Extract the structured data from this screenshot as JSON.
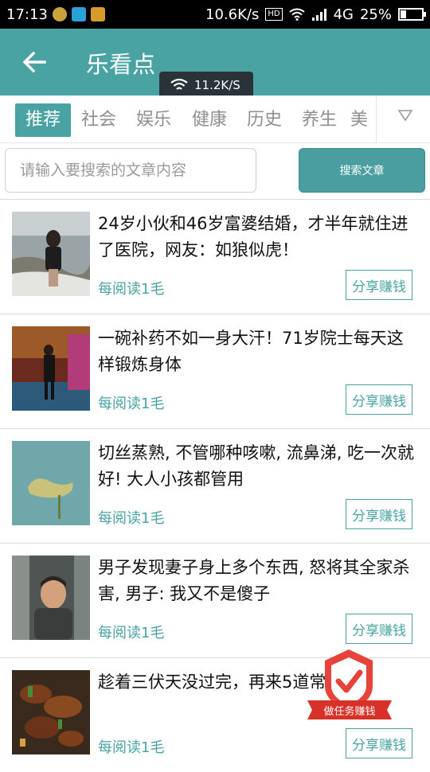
{
  "status_bar": {
    "time": "17:13",
    "net_speed": "10.6K/s",
    "hd": "HD",
    "network": "4G",
    "battery": "25%",
    "battery_level": 0.25
  },
  "app_bar": {
    "title": "乐看点",
    "network_toast": "11.2K/S"
  },
  "tabs": [
    {
      "label": "推荐",
      "active": true
    },
    {
      "label": "社会",
      "active": false
    },
    {
      "label": "娱乐",
      "active": false
    },
    {
      "label": "健康",
      "active": false
    },
    {
      "label": "历史",
      "active": false
    },
    {
      "label": "养生",
      "active": false
    },
    {
      "label": "美",
      "active": false
    }
  ],
  "search": {
    "placeholder": "请输入要搜索的文章内容",
    "button_label": "搜索文章"
  },
  "articles": [
    {
      "title": "24岁小伙和46岁富婆结婚，才半年就住进了医院，网友：如狼似虎！",
      "meta": "每阅读1毛",
      "share_label": "分享赚钱"
    },
    {
      "title": "一碗补药不如一身大汗！71岁院士每天这样锻炼身体",
      "meta": "每阅读1毛",
      "share_label": "分享赚钱"
    },
    {
      "title": "切丝蒸熟, 不管哪种咳嗽, 流鼻涕, 吃一次就好! 大人小孩都管用",
      "meta": "每阅读1毛",
      "share_label": "分享赚钱"
    },
    {
      "title": "男子发现妻子身上多个东西, 怒将其全家杀害, 男子: 我又不是傻子",
      "meta": "每阅读1毛",
      "share_label": "分享赚钱"
    },
    {
      "title": "趁着三伏天没过完，再来5道常菜！",
      "meta": "每阅读1毛",
      "share_label": "分享赚钱"
    }
  ],
  "float_badge": {
    "label": "做任务赚钱"
  },
  "colors": {
    "accent": "#4aa3a3",
    "badge_red": "#e8433a"
  }
}
